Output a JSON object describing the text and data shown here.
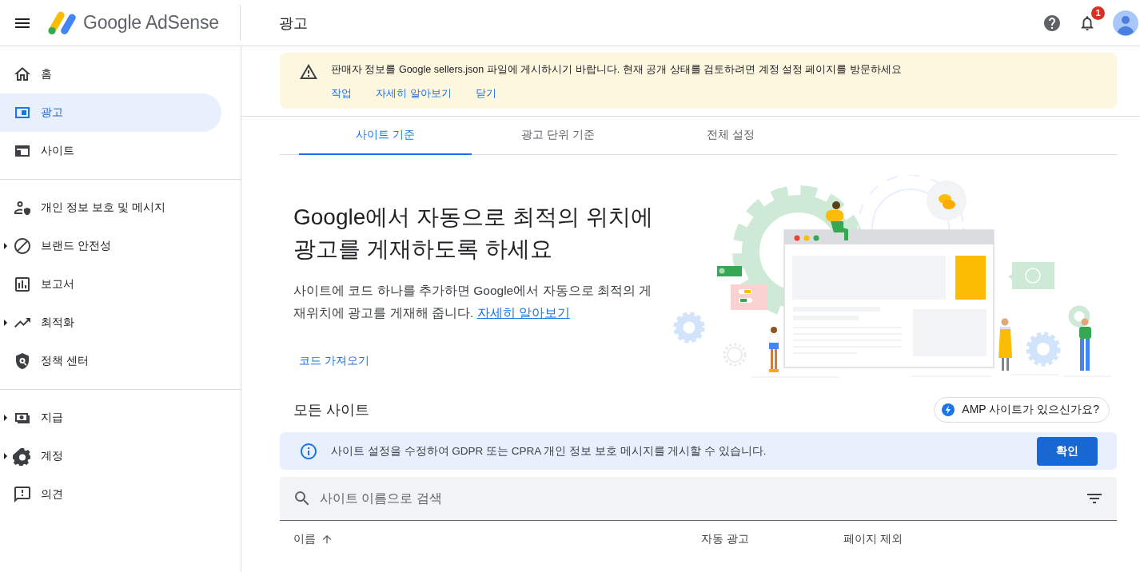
{
  "header": {
    "product_name": "Google AdSense",
    "page_title": "광고",
    "notification_count": "1"
  },
  "sidebar": {
    "sections": [
      {
        "items": [
          {
            "label": "홈",
            "selected": false,
            "expandable": false
          },
          {
            "label": "광고",
            "selected": true,
            "expandable": false
          },
          {
            "label": "사이트",
            "selected": false,
            "expandable": false
          }
        ]
      },
      {
        "items": [
          {
            "label": "개인 정보 보호 및 메시지",
            "selected": false,
            "expandable": false
          },
          {
            "label": "브랜드 안전성",
            "selected": false,
            "expandable": true
          },
          {
            "label": "보고서",
            "selected": false,
            "expandable": false
          },
          {
            "label": "최적화",
            "selected": false,
            "expandable": true
          },
          {
            "label": "정책 센터",
            "selected": false,
            "expandable": false
          }
        ]
      },
      {
        "items": [
          {
            "label": "지급",
            "selected": false,
            "expandable": true
          },
          {
            "label": "계정",
            "selected": false,
            "expandable": true
          },
          {
            "label": "의견",
            "selected": false,
            "expandable": false
          }
        ]
      }
    ]
  },
  "banner": {
    "message": "판매자 정보를 Google sellers.json 파일에 게시하시기 바랍니다. 현재 공개 상태를 검토하려면 계정 설정 페이지를 방문하세요",
    "actions": [
      "작업",
      "자세히 알아보기",
      "닫기"
    ]
  },
  "tabs": [
    {
      "label": "사이트 기준",
      "selected": true
    },
    {
      "label": "광고 단위 기준",
      "selected": false
    },
    {
      "label": "전체 설정",
      "selected": false
    }
  ],
  "hero": {
    "heading": "Google에서 자동으로 최적의 위치에 광고를 게재하도록 하세요",
    "description": "사이트에 코드 하나를 추가하면 Google에서 자동으로 최적의 게재위치에 광고를 게재해 줍니다.",
    "link": "자세히 알아보기",
    "action": "코드 가져오기"
  },
  "sites": {
    "title": "모든 사이트",
    "amp_button": "AMP 사이트가 있으신가요?"
  },
  "notice": {
    "message": "사이트 설정을 수정하여 GDPR 또는 CPRA 개인 정보 보호 메시지를 게시할 수 있습니다.",
    "button": "확인"
  },
  "search": {
    "placeholder": "사이트 이름으로 검색"
  },
  "table": {
    "columns": [
      {
        "label": "이름",
        "sort_ascending": true
      },
      {
        "label": "자동 광고"
      },
      {
        "label": "페이지 제외"
      }
    ]
  }
}
